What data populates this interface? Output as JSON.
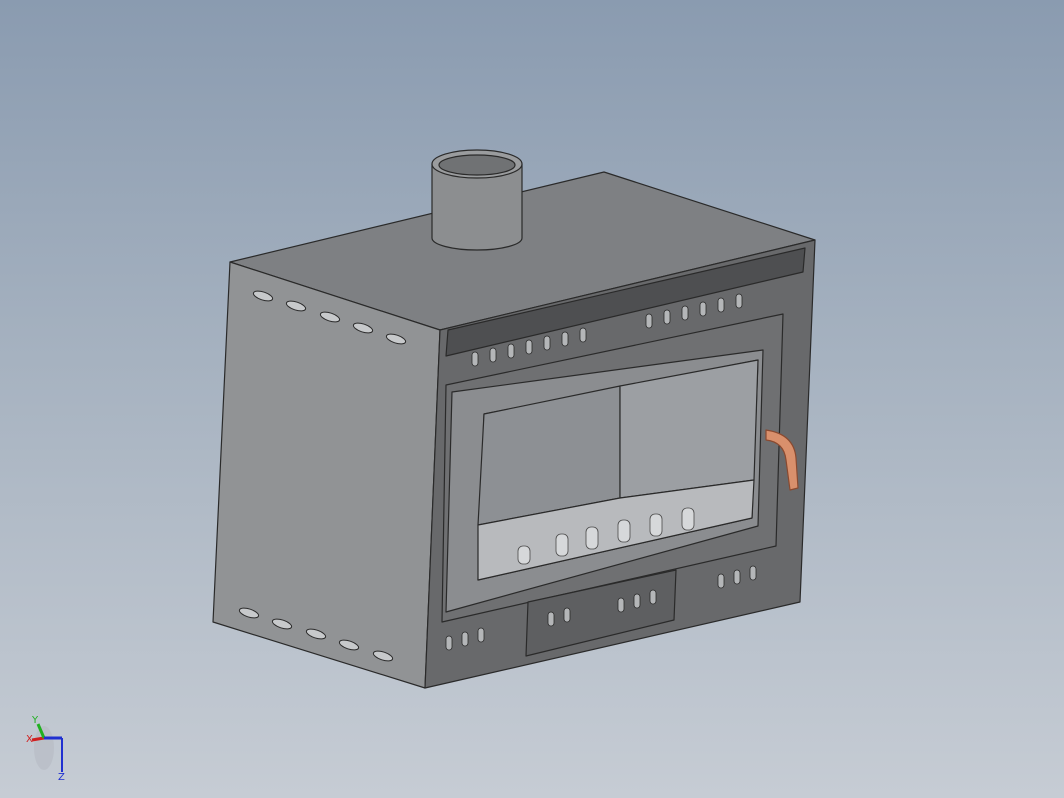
{
  "viewport": {
    "background_top": "#8a9bb0",
    "background_bottom": "#c6ccd4",
    "model": {
      "name": "fireplace-insert",
      "body_color": "#8e9194",
      "front_frame_color": "#5c5e60",
      "glass_color": "#9a9ca0",
      "handle_color": "#d9906c"
    }
  },
  "triad": {
    "x_label": "X",
    "y_label": "Y",
    "z_label": "Z",
    "x_color": "#d02020",
    "y_color": "#20b020",
    "z_color": "#2030d0"
  }
}
